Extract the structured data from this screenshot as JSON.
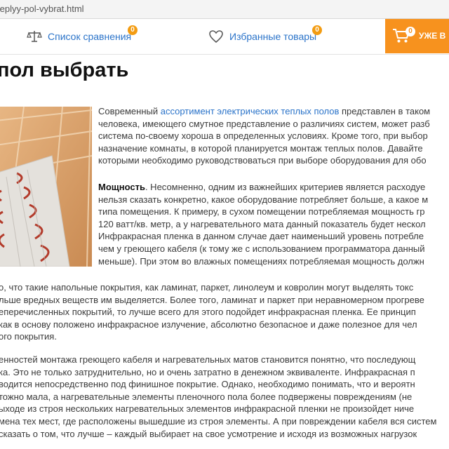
{
  "browser": {
    "url_fragment": "teplyy-pol-vybrat.html"
  },
  "header": {
    "compare": {
      "label": "Список сравнения",
      "count": "0"
    },
    "favorites": {
      "label": "Избранные товары",
      "count": "0"
    },
    "cart": {
      "label": "УЖЕ В",
      "count": "0"
    }
  },
  "article": {
    "title": "пол выбрать",
    "intro": {
      "line1_pre": "Современный ",
      "line1_link": "ассортимент электрических теплых полов",
      "line1_post": " представлен в таком",
      "lines": [
        "человека, имеющего смутное представление о различиях систем, может разб",
        "система по-своему хороша в определенных условиях. Кроме того, при выбор",
        "назначение комнаты, в которой планируется монтаж теплых полов. Давайте",
        "которыми необходимо руководствоваться при выборе оборудования для обо"
      ]
    },
    "power": {
      "label": "Мощность",
      "line1_post": ". Несомненно, одним из важнейших критериев является расходуе",
      "lines": [
        "нельзя сказать конкретно, какое оборудование потребляет больше, а какое м",
        "типа помещения. К примеру, в сухом помещении потребляемая мощность гр",
        "120 ватт/кв. метр, а у нагревательного мата данный показатель будет нескол",
        "Инфракрасная пленка в данном случае дает наименьший уровень потребле",
        "чем у греющего кабеля (к тому же с использованием программатора данный",
        "меньше). При этом во влажных помещениях потребляемая мощность должн"
      ]
    },
    "paragraph3": [
      "о, что такие напольные покрытия, как ламинат, паркет, линолеум и ковролин могут выделять токс",
      "льше вредных веществ им выделяется. Более того, ламинат и паркет при неравномерном прогреве",
      "еперечисленных покрытий, то лучше всего для этого подойдет инфракрасная пленка. Ее принцип",
      "как в основу положено инфракрасное излучение, абсолютно безопасное и даже полезное для чел",
      "ого покрытия."
    ],
    "paragraph4": [
      "енностей монтажа греющего кабеля и нагревательных матов становится понятно, что последующ",
      "ка. Это не только затруднительно, но и очень затратно в денежном эквиваленте. Инфракрасная п",
      "водится непосредственно под финишное покрытие. Однако, необходимо понимать, что и вероятн",
      "тожно мала, а нагревательные элементы пленочного пола более подвержены повреждениям (не",
      "ыходе из строя нескольких нагревательных элементов инфракрасной пленки не произойдет ниче",
      "мена тех мест, где расположены вышедшие из строя элементы. А при повреждении кабеля вся систем",
      "сказать о том, что лучше – каждый выбирает на свое усмотрение и исходя из возможных нагрузок"
    ]
  },
  "colors": {
    "link": "#2a73c9",
    "accent": "#f7921e",
    "badge": "#f39c12"
  },
  "icons": [
    "scales-icon",
    "heart-icon",
    "cart-icon"
  ]
}
